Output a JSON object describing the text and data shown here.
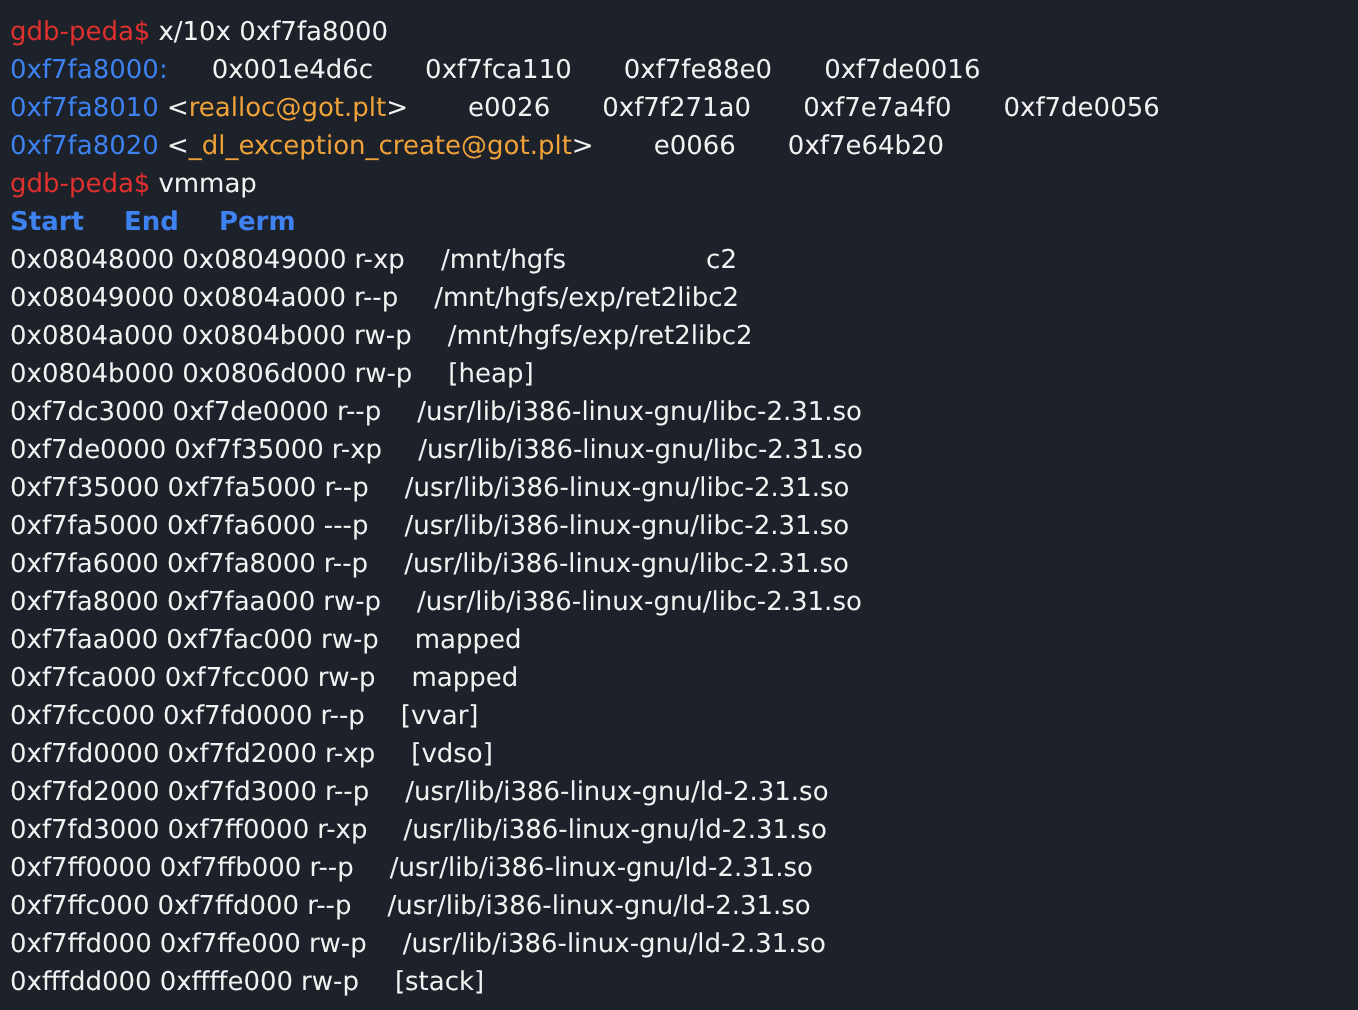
{
  "lines": [
    {
      "kind": "prompt",
      "prompt": "gdb-peda$",
      "command": "x/10x 0xf7fa8000"
    },
    {
      "kind": "memory",
      "address": "0xf7fa8000:",
      "values": [
        "0x001e4d6c",
        "0xf7fca110",
        "0xf7fe88e0",
        "0xf7de0016"
      ]
    },
    {
      "kind": "memory",
      "address": "0xf7fa8010",
      "symbol_open": "<",
      "symbol": "realloc@got.plt",
      "symbol_close": ">",
      "values": [
        "e0026",
        "0xf7f271a0",
        "0xf7e7a4f0",
        "0xf7de0056"
      ]
    },
    {
      "kind": "memory",
      "address": "0xf7fa8020",
      "symbol_open": "<",
      "symbol": "_dl_exception_create@got.plt",
      "symbol_close": ">",
      "values": [
        "e0066",
        "0xf7e64b20"
      ]
    },
    {
      "kind": "prompt",
      "prompt": "gdb-peda$",
      "command": "vmmap"
    },
    {
      "kind": "header",
      "columns": [
        "Start",
        "End",
        "Perm"
      ]
    },
    {
      "kind": "map",
      "start": "0x08048000",
      "end": "0x08049000",
      "perm": "r-xp",
      "name": "/mnt/hgfs",
      "tail": "c2"
    },
    {
      "kind": "map",
      "start": "0x08049000",
      "end": "0x0804a000",
      "perm": "r--p",
      "name": "/mnt/hgfs/exp/ret2libc2"
    },
    {
      "kind": "map",
      "start": "0x0804a000",
      "end": "0x0804b000",
      "perm": "rw-p",
      "name": "/mnt/hgfs/exp/ret2libc2"
    },
    {
      "kind": "map",
      "start": "0x0804b000",
      "end": "0x0806d000",
      "perm": "rw-p",
      "name": "[heap]"
    },
    {
      "kind": "map",
      "start": "0xf7dc3000",
      "end": "0xf7de0000",
      "perm": "r--p",
      "name": "/usr/lib/i386-linux-gnu/libc-2.31.so"
    },
    {
      "kind": "map",
      "start": "0xf7de0000",
      "end": "0xf7f35000",
      "perm": "r-xp",
      "name": "/usr/lib/i386-linux-gnu/libc-2.31.so"
    },
    {
      "kind": "map",
      "start": "0xf7f35000",
      "end": "0xf7fa5000",
      "perm": "r--p",
      "name": "/usr/lib/i386-linux-gnu/libc-2.31.so"
    },
    {
      "kind": "map",
      "start": "0xf7fa5000",
      "end": "0xf7fa6000",
      "perm": "---p",
      "name": "/usr/lib/i386-linux-gnu/libc-2.31.so"
    },
    {
      "kind": "map",
      "start": "0xf7fa6000",
      "end": "0xf7fa8000",
      "perm": "r--p",
      "name": "/usr/lib/i386-linux-gnu/libc-2.31.so"
    },
    {
      "kind": "map",
      "start": "0xf7fa8000",
      "end": "0xf7faa000",
      "perm": "rw-p",
      "name": "/usr/lib/i386-linux-gnu/libc-2.31.so"
    },
    {
      "kind": "map",
      "start": "0xf7faa000",
      "end": "0xf7fac000",
      "perm": "rw-p",
      "name": "mapped"
    },
    {
      "kind": "map",
      "start": "0xf7fca000",
      "end": "0xf7fcc000",
      "perm": "rw-p",
      "name": "mapped"
    },
    {
      "kind": "map",
      "start": "0xf7fcc000",
      "end": "0xf7fd0000",
      "perm": "r--p",
      "name": "[vvar]"
    },
    {
      "kind": "map",
      "start": "0xf7fd0000",
      "end": "0xf7fd2000",
      "perm": "r-xp",
      "name": "[vdso]"
    },
    {
      "kind": "map",
      "start": "0xf7fd2000",
      "end": "0xf7fd3000",
      "perm": "r--p",
      "name": "/usr/lib/i386-linux-gnu/ld-2.31.so"
    },
    {
      "kind": "map",
      "start": "0xf7fd3000",
      "end": "0xf7ff0000",
      "perm": "r-xp",
      "name": "/usr/lib/i386-linux-gnu/ld-2.31.so"
    },
    {
      "kind": "map",
      "start": "0xf7ff0000",
      "end": "0xf7ffb000",
      "perm": "r--p",
      "name": "/usr/lib/i386-linux-gnu/ld-2.31.so"
    },
    {
      "kind": "map",
      "start": "0xf7ffc000",
      "end": "0xf7ffd000",
      "perm": "r--p",
      "name": "/usr/lib/i386-linux-gnu/ld-2.31.so"
    },
    {
      "kind": "map",
      "start": "0xf7ffd000",
      "end": "0xf7ffe000",
      "perm": "rw-p",
      "name": "/usr/lib/i386-linux-gnu/ld-2.31.so"
    },
    {
      "kind": "map",
      "start": "0xfffdd000",
      "end": "0xffffe000",
      "perm": "rw-p",
      "name": "[stack]"
    }
  ]
}
